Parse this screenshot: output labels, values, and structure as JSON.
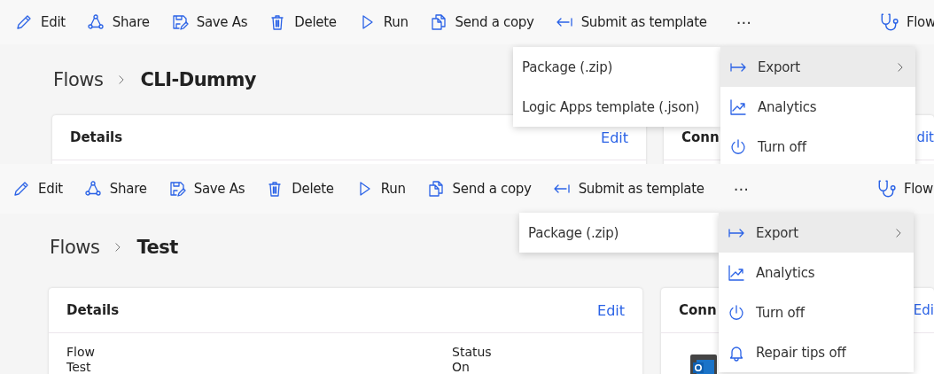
{
  "panels": [
    {
      "toolbar": {
        "items": [
          {
            "label": "Edit"
          },
          {
            "label": "Share"
          },
          {
            "label": "Save As"
          },
          {
            "label": "Delete"
          },
          {
            "label": "Run"
          },
          {
            "label": "Send a copy"
          },
          {
            "label": "Submit as template"
          }
        ],
        "more": "···",
        "right_item": {
          "label": "Flow"
        }
      },
      "breadcrumb": {
        "parent": "Flows",
        "current": "CLI-Dummy"
      },
      "details_card": {
        "title": "Details",
        "edit_link": "Edit"
      },
      "connections_card": {
        "title": "Conn",
        "edit_link": "dit"
      },
      "menu": [
        {
          "label": "Export",
          "selected": true,
          "has_submenu": true
        },
        {
          "label": "Analytics",
          "selected": false,
          "has_submenu": false
        },
        {
          "label": "Turn off",
          "selected": false,
          "has_submenu": false
        }
      ],
      "submenu": [
        {
          "label": "Package (.zip)"
        },
        {
          "label": "Logic Apps template (.json)"
        }
      ]
    },
    {
      "toolbar": {
        "items": [
          {
            "label": "Edit"
          },
          {
            "label": "Share"
          },
          {
            "label": "Save As"
          },
          {
            "label": "Delete"
          },
          {
            "label": "Run"
          },
          {
            "label": "Send a copy"
          },
          {
            "label": "Submit as template"
          }
        ],
        "more": "···",
        "right_item": {
          "label": "Flow"
        }
      },
      "breadcrumb": {
        "parent": "Flows",
        "current": "Test"
      },
      "details_card": {
        "title": "Details",
        "edit_link": "Edit",
        "fields": [
          {
            "label": "Flow",
            "value": "Test"
          },
          {
            "label": "Status",
            "value": "On"
          }
        ]
      },
      "connections_card": {
        "title": "Conn",
        "edit_link": "Edi",
        "app_icon": true
      },
      "menu": [
        {
          "label": "Export",
          "selected": true,
          "has_submenu": true
        },
        {
          "label": "Analytics",
          "selected": false,
          "has_submenu": false
        },
        {
          "label": "Turn off",
          "selected": false,
          "has_submenu": false
        },
        {
          "label": "Repair tips off",
          "selected": false,
          "has_submenu": false
        }
      ],
      "submenu": [
        {
          "label": "Package (.zip)"
        }
      ]
    }
  ]
}
